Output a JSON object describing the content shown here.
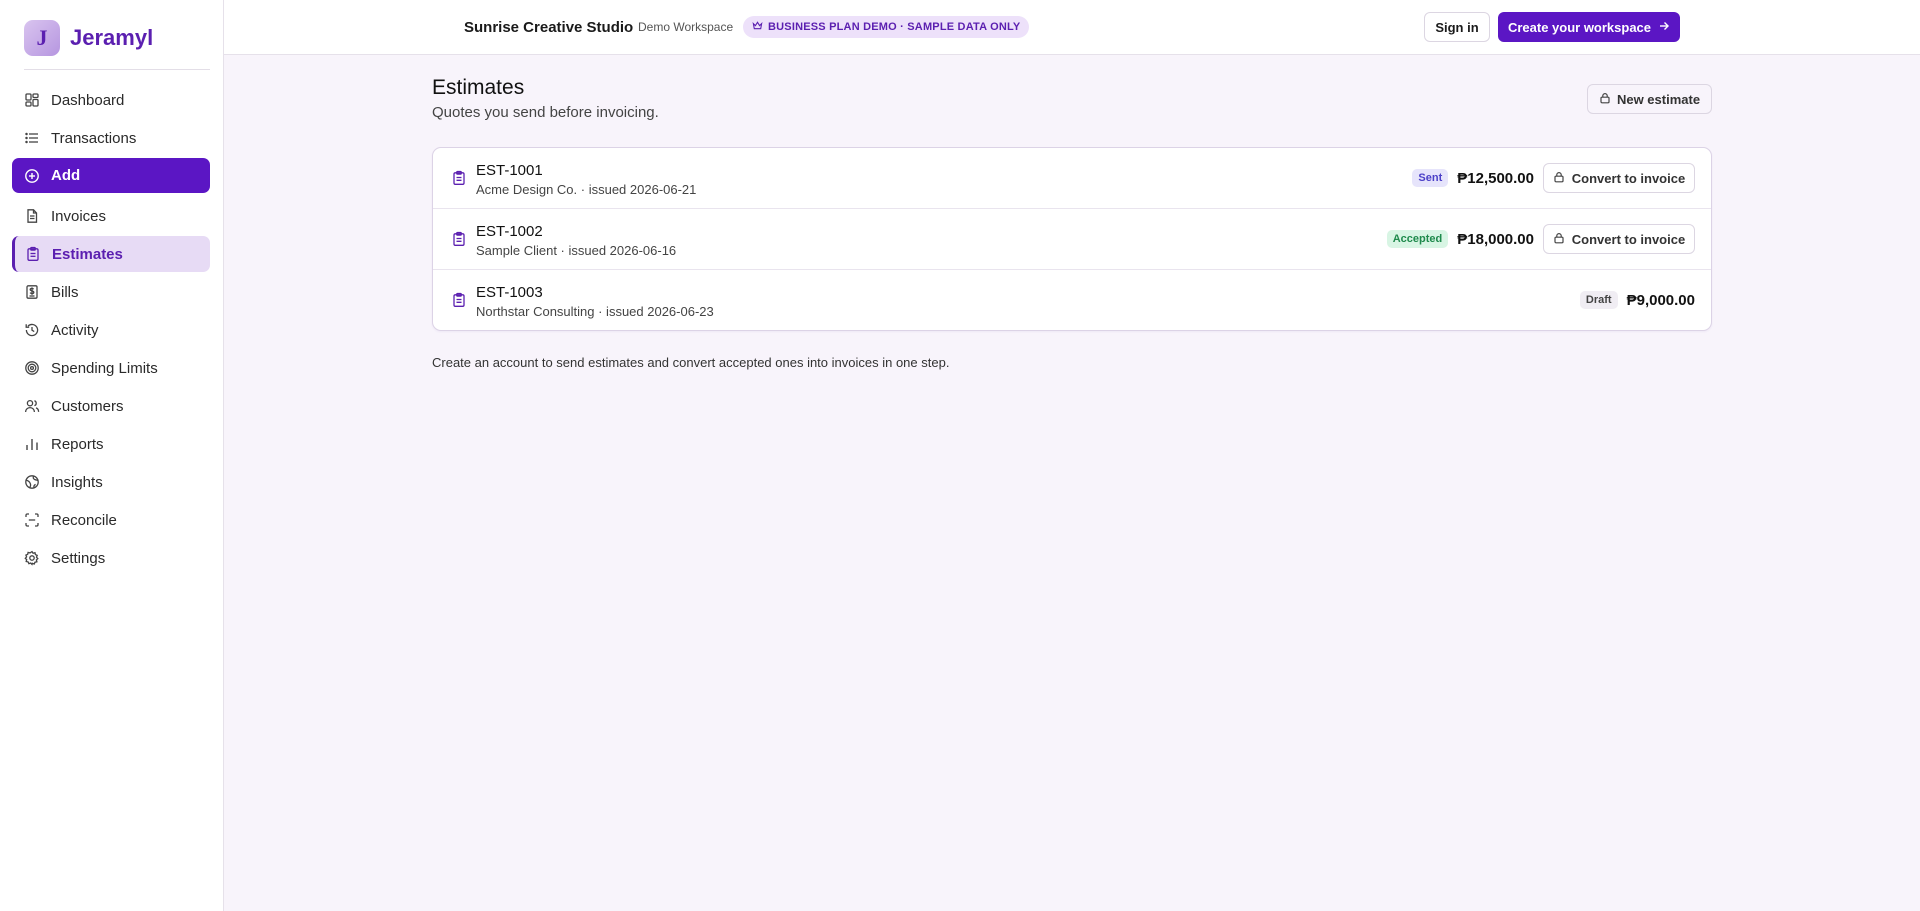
{
  "brand": {
    "name": "Jeramyl",
    "logo_letter": "J"
  },
  "sidebar": {
    "items": [
      {
        "label": "Dashboard",
        "icon": "dashboard-icon"
      },
      {
        "label": "Transactions",
        "icon": "list-icon"
      },
      {
        "label": "Add",
        "icon": "plus-circle-icon"
      },
      {
        "label": "Invoices",
        "icon": "document-icon"
      },
      {
        "label": "Estimates",
        "icon": "clipboard-icon"
      },
      {
        "label": "Bills",
        "icon": "receipt-icon"
      },
      {
        "label": "Activity",
        "icon": "history-icon"
      },
      {
        "label": "Spending Limits",
        "icon": "target-icon"
      },
      {
        "label": "Customers",
        "icon": "users-icon"
      },
      {
        "label": "Reports",
        "icon": "bar-chart-icon"
      },
      {
        "label": "Insights",
        "icon": "globe-icon"
      },
      {
        "label": "Reconcile",
        "icon": "scan-icon"
      },
      {
        "label": "Settings",
        "icon": "gear-icon"
      }
    ]
  },
  "header": {
    "workspace_name": "Sunrise Creative Studio",
    "workspace_sub": "Demo Workspace",
    "plan_badge": "BUSINESS PLAN DEMO · SAMPLE DATA ONLY",
    "sign_in_label": "Sign in",
    "create_label": "Create your workspace"
  },
  "page": {
    "title": "Estimates",
    "subtitle": "Quotes you send before invoicing.",
    "new_button_label": "New estimate",
    "footnote": "Create an account to send estimates and convert accepted ones into invoices in one step."
  },
  "estimates": [
    {
      "id": "EST-1001",
      "meta": "Acme Design Co. · issued 2026-06-21",
      "status": "Sent",
      "amount": "₱12,500.00",
      "action": "Convert to invoice"
    },
    {
      "id": "EST-1002",
      "meta": "Sample Client · issued 2026-06-16",
      "status": "Accepted",
      "amount": "₱18,000.00",
      "action": "Convert to invoice"
    },
    {
      "id": "EST-1003",
      "meta": "Northstar Consulting · issued 2026-06-23",
      "status": "Draft",
      "amount": "₱9,000.00",
      "action": ""
    }
  ],
  "colors": {
    "accent": "#5b16c4",
    "background": "#f8f4fb",
    "status_sent": "#4b3fc8",
    "status_accepted": "#1f8a4c"
  }
}
